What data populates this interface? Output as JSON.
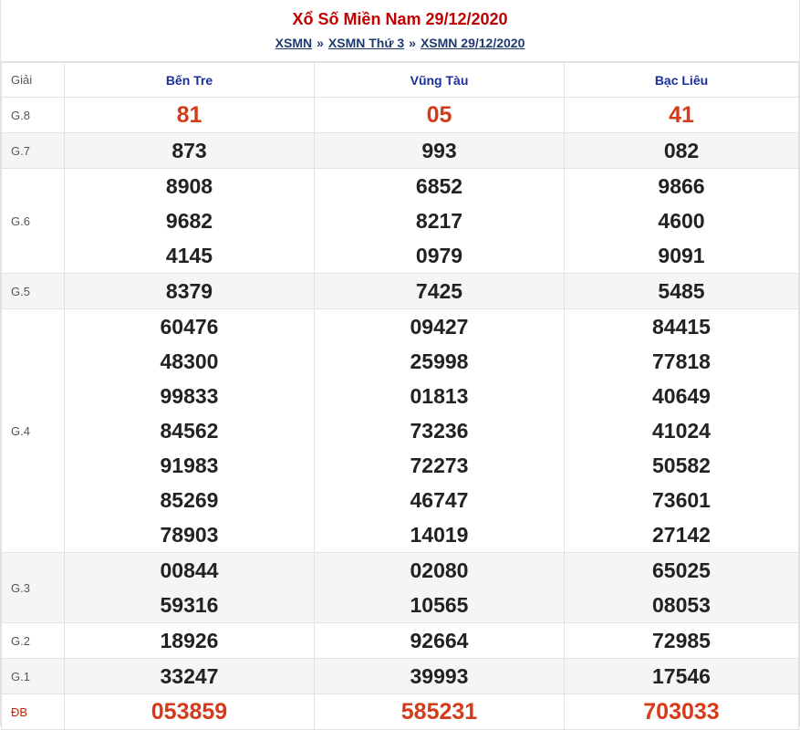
{
  "title": "Xổ Số Miền Nam 29/12/2020",
  "breadcrumb": [
    {
      "label": "XSMN"
    },
    {
      "label": "XSMN Thứ 3"
    },
    {
      "label": "XSMN 29/12/2020"
    }
  ],
  "breadcrumb_sep": "»",
  "table": {
    "giai_header": "Giải",
    "provinces": [
      "Bến Tre",
      "Vũng Tàu",
      "Bạc Liêu"
    ],
    "rows": [
      {
        "label": "G.8",
        "values": [
          [
            "81"
          ],
          [
            "05"
          ],
          [
            "41"
          ]
        ]
      },
      {
        "label": "G.7",
        "values": [
          [
            "873"
          ],
          [
            "993"
          ],
          [
            "082"
          ]
        ]
      },
      {
        "label": "G.6",
        "values": [
          [
            "8908",
            "9682",
            "4145"
          ],
          [
            "6852",
            "8217",
            "0979"
          ],
          [
            "9866",
            "4600",
            "9091"
          ]
        ]
      },
      {
        "label": "G.5",
        "values": [
          [
            "8379"
          ],
          [
            "7425"
          ],
          [
            "5485"
          ]
        ]
      },
      {
        "label": "G.4",
        "values": [
          [
            "60476",
            "48300",
            "99833",
            "84562",
            "91983",
            "85269",
            "78903"
          ],
          [
            "09427",
            "25998",
            "01813",
            "73236",
            "72273",
            "46747",
            "14019"
          ],
          [
            "84415",
            "77818",
            "40649",
            "41024",
            "50582",
            "73601",
            "27142"
          ]
        ]
      },
      {
        "label": "G.3",
        "values": [
          [
            "00844",
            "59316"
          ],
          [
            "02080",
            "10565"
          ],
          [
            "65025",
            "08053"
          ]
        ]
      },
      {
        "label": "G.2",
        "values": [
          [
            "18926"
          ],
          [
            "92664"
          ],
          [
            "72985"
          ]
        ]
      },
      {
        "label": "G.1",
        "values": [
          [
            "33247"
          ],
          [
            "39993"
          ],
          [
            "17546"
          ]
        ]
      },
      {
        "label": "ĐB",
        "values": [
          [
            "053859"
          ],
          [
            "585231"
          ],
          [
            "703033"
          ]
        ]
      }
    ]
  },
  "colors": {
    "title": "#c00000",
    "prize_red": "#d63a18",
    "province": "#1a2e9e",
    "link": "#1e3a6e"
  }
}
